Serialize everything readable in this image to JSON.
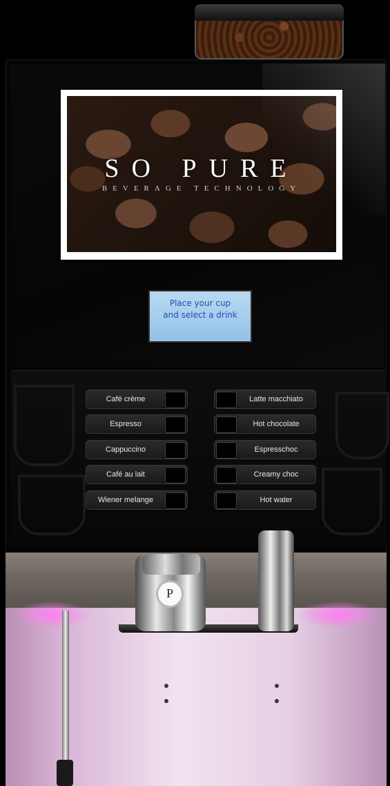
{
  "screen": {
    "brand": "SO PURE",
    "tagline": "BEVERAGE TECHNOLOGY"
  },
  "lcd": {
    "line1": "Place your cup",
    "line2": "and select a drink"
  },
  "badge": {
    "letter": "P"
  },
  "drinks": {
    "left": [
      {
        "label": "Café crème"
      },
      {
        "label": "Espresso"
      },
      {
        "label": "Cappuccino"
      },
      {
        "label": "Café au lait"
      },
      {
        "label": "Wiener melange"
      }
    ],
    "right": [
      {
        "label": "Latte macchiato"
      },
      {
        "label": "Hot chocolate"
      },
      {
        "label": "Espresschoc"
      },
      {
        "label": "Creamy choc"
      },
      {
        "label": "Hot water"
      }
    ]
  },
  "colors": {
    "lcd_background": "#a7cdec",
    "led_glow": "#ff7ff0",
    "panel": "#070707"
  }
}
